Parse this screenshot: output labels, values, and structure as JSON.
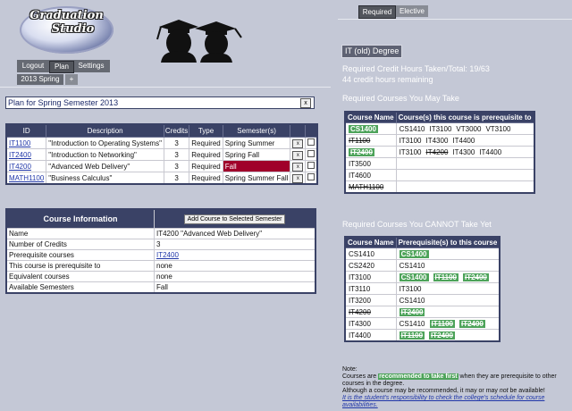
{
  "logo": {
    "line1": "Graduation",
    "line2": "Studio"
  },
  "nav": {
    "items": [
      "Logout",
      "Plan",
      "Settings"
    ],
    "active": "Plan"
  },
  "semester_tab": {
    "label": "2013 Spring",
    "add_label": "+"
  },
  "plan": {
    "title": "Plan for Spring Semester 2013",
    "close_label": "x",
    "columns": [
      "ID",
      "Description",
      "Credits",
      "Type",
      "Semester(s)"
    ],
    "rows": [
      {
        "id": "IT1100",
        "description": "\"Introduction to Operating Systems\"",
        "credits": "3",
        "type": "Required",
        "semesters": "Spring Summer",
        "highlight": false
      },
      {
        "id": "IT2400",
        "description": "\"Introduction to Networking\"",
        "credits": "3",
        "type": "Required",
        "semesters": "Spring Fall",
        "highlight": false
      },
      {
        "id": "IT4200",
        "description": "\"Advanced Web Delivery\"",
        "credits": "3",
        "type": "Required",
        "semesters": "Fall",
        "highlight": true
      },
      {
        "id": "MATH1100",
        "description": "\"Business Calculus\"",
        "credits": "3",
        "type": "Required",
        "semesters": "Spring Summer Fall",
        "highlight": false
      }
    ],
    "remove_label": "x"
  },
  "course_info": {
    "header": "Course Information",
    "add_button": "Add Course to Selected Semester",
    "rows": [
      {
        "label": "Name",
        "value": "IT4200 \"Advanced Web Delivery\"",
        "link": false
      },
      {
        "label": "Number of Credits",
        "value": "3",
        "link": false
      },
      {
        "label": "Prerequisite courses",
        "value": "IT2400",
        "link": true
      },
      {
        "label": "This course is prerequisite to",
        "value": "none",
        "link": false
      },
      {
        "label": "Equivalent courses",
        "value": "none",
        "link": false
      },
      {
        "label": "Available Semesters",
        "value": "Fall",
        "link": false
      }
    ]
  },
  "right_tabs": {
    "items": [
      "Required",
      "Elective"
    ],
    "active": "Required"
  },
  "degree": {
    "label": "IT (old) Degree",
    "credit_summary": "Required Credit Hours Taken/Total: 19/63",
    "remaining": "44 credit hours remaining"
  },
  "may_take": {
    "title": "Required Courses You May Take",
    "columns": [
      "Course Name",
      "Course(s) this course is prerequisite to"
    ],
    "rows": [
      {
        "course": "CS1400",
        "course_style": "green",
        "targets": [
          {
            "t": "CS1410",
            "s": "plain"
          },
          {
            "t": "IT3100",
            "s": "plain"
          },
          {
            "t": "VT3000",
            "s": "plain"
          },
          {
            "t": "VT3100",
            "s": "plain"
          }
        ]
      },
      {
        "course": "IT1100",
        "course_style": "strike",
        "targets": [
          {
            "t": "IT3100",
            "s": "plain"
          },
          {
            "t": "IT4300",
            "s": "plain"
          },
          {
            "t": "IT4400",
            "s": "plain"
          }
        ]
      },
      {
        "course": "IT2400",
        "course_style": "green-strike",
        "targets": [
          {
            "t": "IT3100",
            "s": "plain"
          },
          {
            "t": "IT4200",
            "s": "strike"
          },
          {
            "t": "IT4300",
            "s": "plain"
          },
          {
            "t": "IT4400",
            "s": "plain"
          }
        ]
      },
      {
        "course": "IT3500",
        "course_style": "plain",
        "targets": []
      },
      {
        "course": "IT4600",
        "course_style": "plain",
        "targets": []
      },
      {
        "course": "MATH1100",
        "course_style": "strike",
        "targets": []
      }
    ]
  },
  "cannot_take": {
    "title": "Required Courses You CANNOT Take Yet",
    "columns": [
      "Course Name",
      "Prerequisite(s) to this course"
    ],
    "rows": [
      {
        "course": "CS1410",
        "course_style": "plain",
        "targets": [
          {
            "t": "CS1400",
            "s": "green"
          }
        ]
      },
      {
        "course": "CS2420",
        "course_style": "plain",
        "targets": [
          {
            "t": "CS1410",
            "s": "plain"
          }
        ]
      },
      {
        "course": "IT3100",
        "course_style": "plain",
        "targets": [
          {
            "t": "CS1400",
            "s": "green"
          },
          {
            "t": "IT1100",
            "s": "green-strike"
          },
          {
            "t": "IT2400",
            "s": "green-strike"
          }
        ]
      },
      {
        "course": "IT3110",
        "course_style": "plain",
        "targets": [
          {
            "t": "IT3100",
            "s": "plain"
          }
        ]
      },
      {
        "course": "IT3200",
        "course_style": "plain",
        "targets": [
          {
            "t": "CS1410",
            "s": "plain"
          }
        ]
      },
      {
        "course": "IT4200",
        "course_style": "strike",
        "targets": [
          {
            "t": "IT2400",
            "s": "green-strike"
          }
        ]
      },
      {
        "course": "IT4300",
        "course_style": "plain",
        "targets": [
          {
            "t": "CS1410",
            "s": "plain"
          },
          {
            "t": "IT1100",
            "s": "green-strike"
          },
          {
            "t": "IT2400",
            "s": "green-strike"
          }
        ]
      },
      {
        "course": "IT4400",
        "course_style": "plain",
        "targets": [
          {
            "t": "IT1100",
            "s": "green-strike"
          },
          {
            "t": "IT2400",
            "s": "green-strike"
          }
        ]
      }
    ]
  },
  "note": {
    "label": "Note:",
    "line1_pre": "Courses are ",
    "line1_hl": "recommended to take first",
    "line1_post": " when they are prerequisite to other courses in the degree.",
    "line2_pre": "Although a course may be recommended, it may or may ",
    "line2_em": "not",
    "line2_post": " be available!",
    "line3": "It is the student's responsibility to check the college's schedule for course availabilities."
  },
  "colors": {
    "background": "#c4c8d6",
    "header": "#3a4266",
    "green": "#4da35a",
    "red": "#a0002a"
  }
}
